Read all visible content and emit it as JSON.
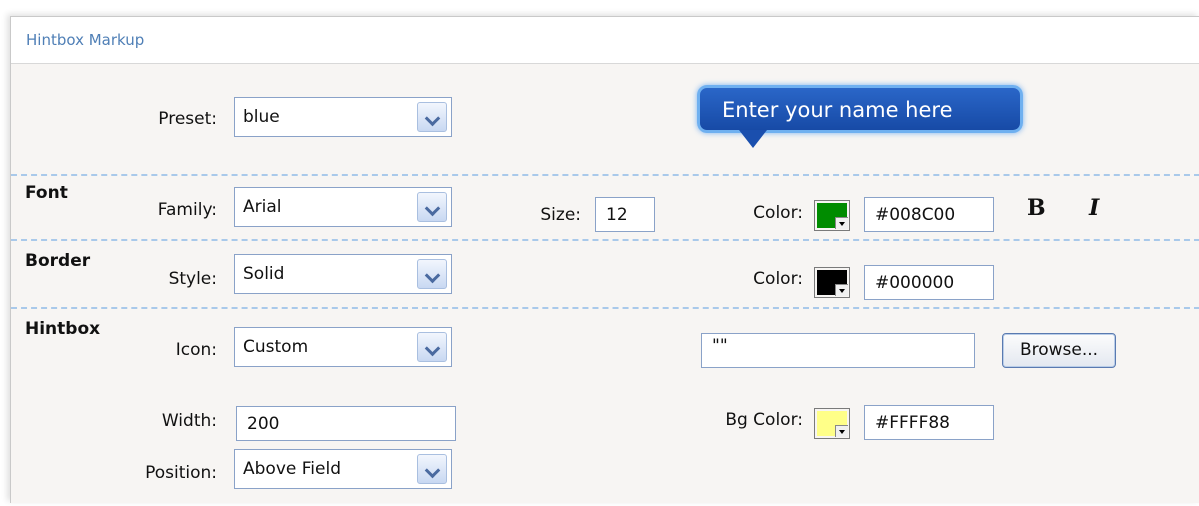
{
  "panel": {
    "title": "Hintbox Markup"
  },
  "preset": {
    "label": "Preset:",
    "value": "blue"
  },
  "tooltip": {
    "text": "Enter your name here"
  },
  "font": {
    "section": "Font",
    "family_label": "Family:",
    "family_value": "Arial",
    "size_label": "Size:",
    "size_value": "12",
    "color_label": "Color:",
    "color_value": "#008C00",
    "swatch_color": "#008C00",
    "bold_label": "B",
    "italic_label": "I"
  },
  "border": {
    "section": "Border",
    "style_label": "Style:",
    "style_value": "Solid",
    "color_label": "Color:",
    "color_value": "#000000",
    "swatch_color": "#000000"
  },
  "hintbox": {
    "section": "Hintbox",
    "icon_label": "Icon:",
    "icon_value": "Custom",
    "icon_path_value": "\"\"",
    "browse_label": "Browse...",
    "width_label": "Width:",
    "width_value": "200",
    "bg_color_label": "Bg Color:",
    "bg_color_value": "#FFFF88",
    "swatch_color": "#FFFF88",
    "position_label": "Position:",
    "position_value": "Above Field"
  }
}
